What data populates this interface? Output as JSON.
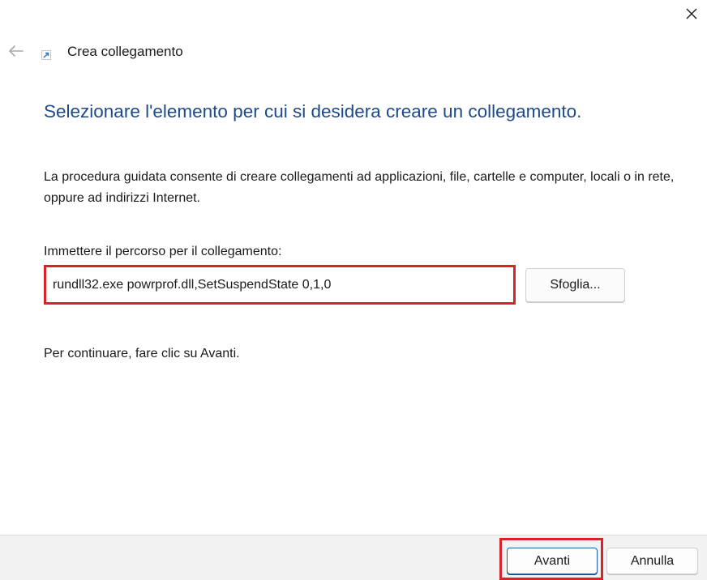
{
  "window": {
    "title": "Crea collegamento",
    "icons": {
      "close": "close-icon",
      "back": "back-arrow-icon",
      "app": "shortcut-icon"
    }
  },
  "main": {
    "heading": "Selezionare l'elemento per cui si desidera creare un collegamento.",
    "description": "La procedura guidata consente di creare collegamenti ad applicazioni, file, cartelle e computer, locali o in rete, oppure ad indirizzi Internet.",
    "path_label": "Immettere il percorso per il collegamento:",
    "path_value": "rundll32.exe powrprof.dll,SetSuspendState 0,1,0",
    "browse_label": "Sfoglia...",
    "continue_text": "Per continuare, fare clic su Avanti."
  },
  "footer": {
    "next_label": "Avanti",
    "cancel_label": "Annulla"
  },
  "colors": {
    "heading": "#1d4a8c",
    "highlight": "#d8232a",
    "footer_bg": "#f2f2f2",
    "accent_button_border": "#1d5fa8"
  }
}
